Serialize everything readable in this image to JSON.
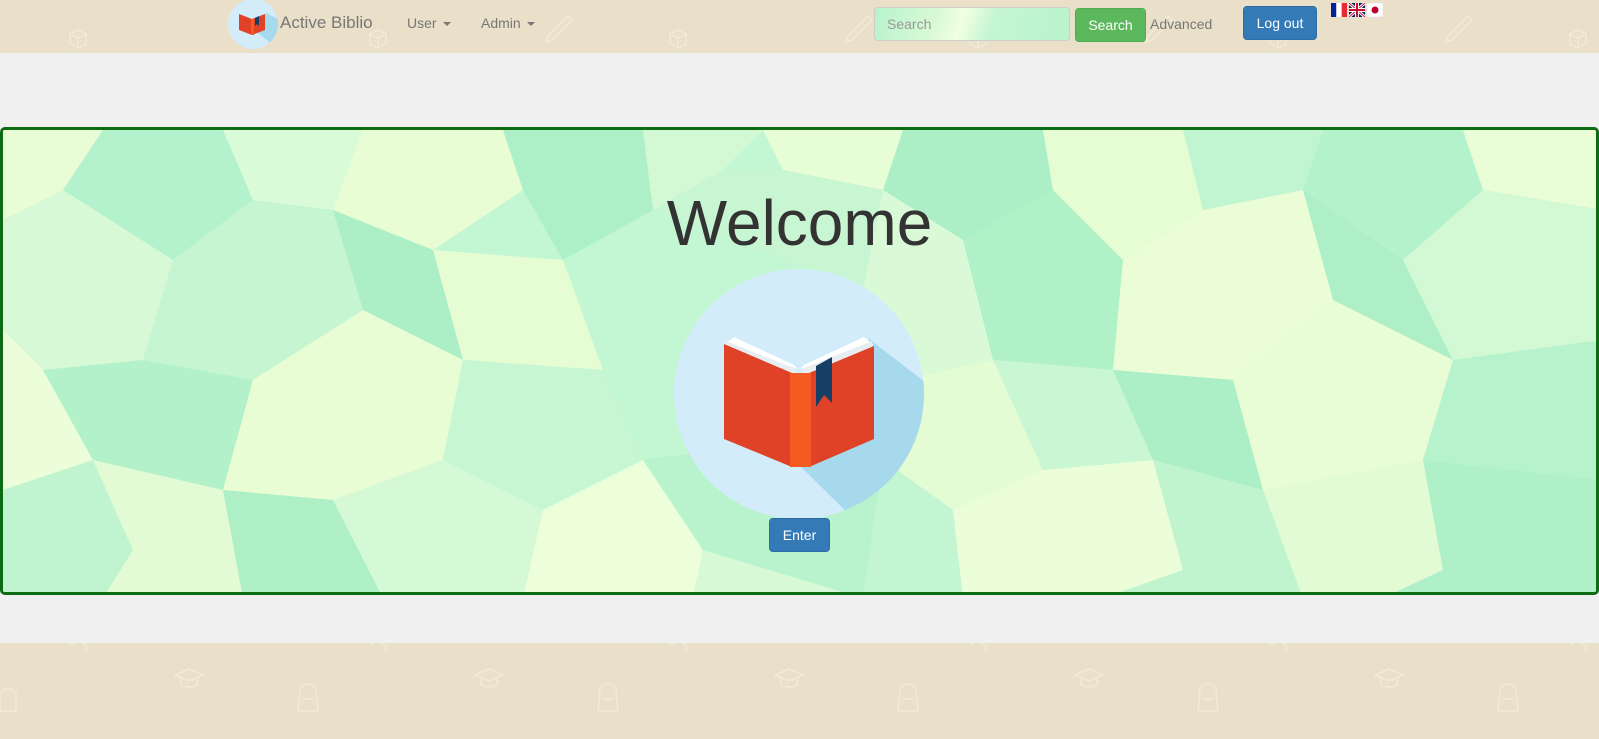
{
  "navbar": {
    "brand_name": "Active Biblio",
    "menus": [
      {
        "label": "User"
      },
      {
        "label": "Admin"
      }
    ],
    "search": {
      "placeholder": "Search",
      "value": "",
      "button_label": "Search",
      "advanced_label": "Advanced"
    },
    "logout_label": "Log out",
    "languages": [
      "fr",
      "en",
      "ja"
    ]
  },
  "main": {
    "title": "Welcome",
    "enter_label": "Enter"
  },
  "colors": {
    "navbar_bg": "#eadfc8",
    "primary": "#337ab7",
    "success": "#5cb85c",
    "jumbotron_border": "#0c6b13",
    "book_red": "#df4226"
  }
}
